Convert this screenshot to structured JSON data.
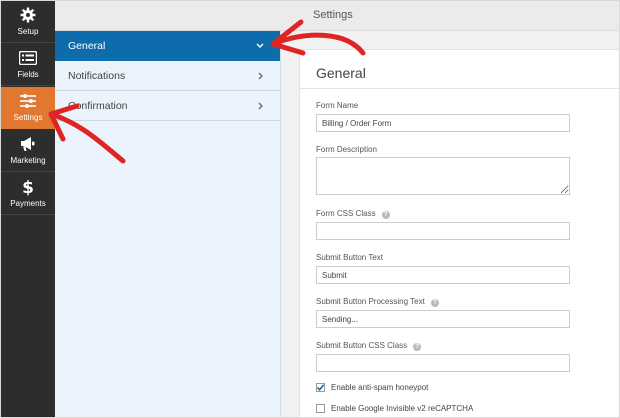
{
  "app": {
    "title": "Settings"
  },
  "rail": {
    "items": [
      {
        "label": "Setup",
        "icon": "gear-icon",
        "active": false
      },
      {
        "label": "Fields",
        "icon": "fields-list-icon",
        "active": false
      },
      {
        "label": "Settings",
        "icon": "sliders-icon",
        "active": true
      },
      {
        "label": "Marketing",
        "icon": "megaphone-icon",
        "active": false
      },
      {
        "label": "Payments",
        "icon": "dollar-icon",
        "active": false
      }
    ],
    "active_color": "#e27730"
  },
  "submenu": {
    "items": [
      {
        "label": "General",
        "active": true
      },
      {
        "label": "Notifications",
        "active": false
      },
      {
        "label": "Confirmation",
        "active": false
      }
    ],
    "active_color": "#0e6cad"
  },
  "general": {
    "heading": "General",
    "form_name": {
      "label": "Form Name",
      "value": "Billing / Order Form"
    },
    "form_description": {
      "label": "Form Description",
      "value": ""
    },
    "form_css_class": {
      "label": "Form CSS Class",
      "value": ""
    },
    "submit_text": {
      "label": "Submit Button Text",
      "value": "Submit"
    },
    "submit_processing_text": {
      "label": "Submit Button Processing Text",
      "value": "Sending..."
    },
    "submit_css_class": {
      "label": "Submit Button CSS Class",
      "value": ""
    },
    "honeypot": {
      "label": "Enable anti-spam honeypot",
      "checked": true
    },
    "recaptcha": {
      "label": "Enable Google Invisible v2 reCAPTCHA",
      "checked": false
    }
  },
  "annotation_color": "#e02424"
}
